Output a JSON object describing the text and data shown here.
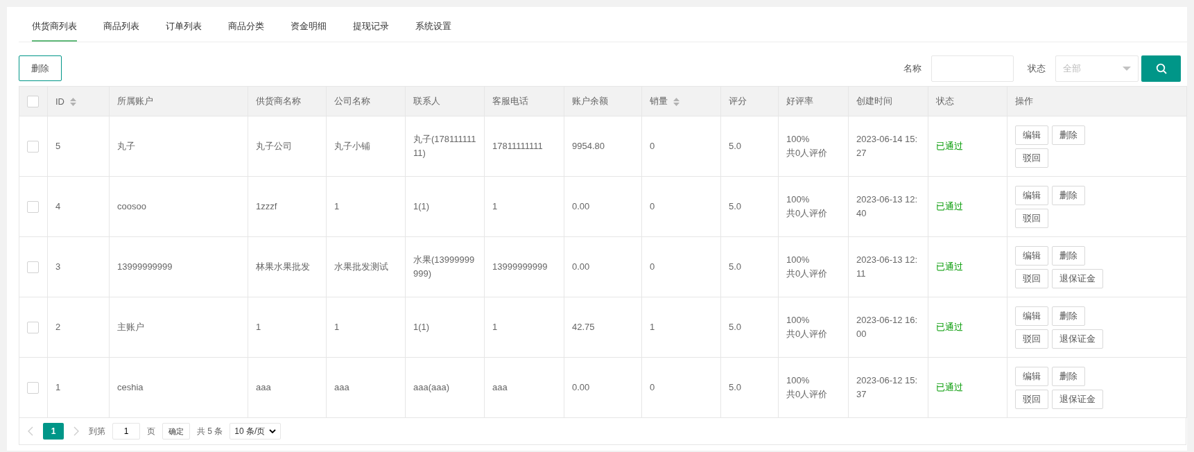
{
  "tabs": [
    {
      "label": "供货商列表",
      "selected": true
    },
    {
      "label": "商品列表",
      "selected": false
    },
    {
      "label": "订单列表",
      "selected": false
    },
    {
      "label": "商品分类",
      "selected": false
    },
    {
      "label": "资金明细",
      "selected": false
    },
    {
      "label": "提现记录",
      "selected": false
    },
    {
      "label": "系统设置",
      "selected": false
    }
  ],
  "toolbar": {
    "delete_button": "删除",
    "name_label": "名称",
    "status_label": "状态",
    "status_select": {
      "placeholder": "全部"
    }
  },
  "table": {
    "header_checkbox": {
      "checked": false
    },
    "columns": [
      {
        "label": "ID",
        "sortable": true
      },
      {
        "label": "所属账户",
        "sortable": false
      },
      {
        "label": "供货商名称",
        "sortable": false
      },
      {
        "label": "公司名称",
        "sortable": false
      },
      {
        "label": "联系人",
        "sortable": false
      },
      {
        "label": "客服电话",
        "sortable": false
      },
      {
        "label": "账户余额",
        "sortable": false
      },
      {
        "label": "销量",
        "sortable": true
      },
      {
        "label": "评分",
        "sortable": false
      },
      {
        "label": "好评率",
        "sortable": false
      },
      {
        "label": "创建时间",
        "sortable": false
      },
      {
        "label": "状态",
        "sortable": false
      },
      {
        "label": "操作",
        "sortable": false
      }
    ],
    "rows": [
      {
        "checked": false,
        "id": "5",
        "account": "丸子",
        "supplier": "丸子公司",
        "company": "丸子小铺",
        "contact": "丸子(17811111111)",
        "phone": "17811111111",
        "balance": "9954.80",
        "sales": "0",
        "rating": "5.0",
        "praise_rate": "100%",
        "review_count": "共0人评价",
        "created": "2023-06-14 15:27",
        "status": "已通过",
        "actions": [
          "编辑",
          "删除",
          "驳回"
        ]
      },
      {
        "checked": false,
        "id": "4",
        "account": "coosoo",
        "supplier": "1zzzf",
        "company": "1",
        "contact": "1(1)",
        "phone": "1",
        "balance": "0.00",
        "sales": "0",
        "rating": "5.0",
        "praise_rate": "100%",
        "review_count": "共0人评价",
        "created": "2023-06-13 12:40",
        "status": "已通过",
        "actions": [
          "编辑",
          "删除",
          "驳回"
        ]
      },
      {
        "checked": false,
        "id": "3",
        "account": "13999999999",
        "supplier": "林果水果批发",
        "company": "水果批发测试",
        "contact": "水果(13999999999)",
        "phone": "13999999999",
        "balance": "0.00",
        "sales": "0",
        "rating": "5.0",
        "praise_rate": "100%",
        "review_count": "共0人评价",
        "created": "2023-06-13 12:11",
        "status": "已通过",
        "actions": [
          "编辑",
          "删除",
          "驳回",
          "退保证金"
        ]
      },
      {
        "checked": false,
        "id": "2",
        "account": "主账户",
        "supplier": "1",
        "company": "1",
        "contact": "1(1)",
        "phone": "1",
        "balance": "42.75",
        "sales": "1",
        "rating": "5.0",
        "praise_rate": "100%",
        "review_count": "共0人评价",
        "created": "2023-06-12 16:00",
        "status": "已通过",
        "actions": [
          "编辑",
          "删除",
          "驳回",
          "退保证金"
        ]
      },
      {
        "checked": false,
        "id": "1",
        "account": "ceshia",
        "supplier": "aaa",
        "company": "aaa",
        "contact": "aaa(aaa)",
        "phone": "aaa",
        "balance": "0.00",
        "sales": "0",
        "rating": "5.0",
        "praise_rate": "100%",
        "review_count": "共0人评价",
        "created": "2023-06-12 15:37",
        "status": "已通过",
        "actions": [
          "编辑",
          "删除",
          "驳回",
          "退保证金"
        ]
      }
    ]
  },
  "pagination": {
    "prev_disabled": true,
    "pages": [
      {
        "label": "1",
        "selected": true
      }
    ],
    "next_disabled": true,
    "goto_label": "到第",
    "goto_value": "1",
    "page_unit": "页",
    "confirm": "确定",
    "total": "共 5 条",
    "page_size": "10 条/页"
  }
}
